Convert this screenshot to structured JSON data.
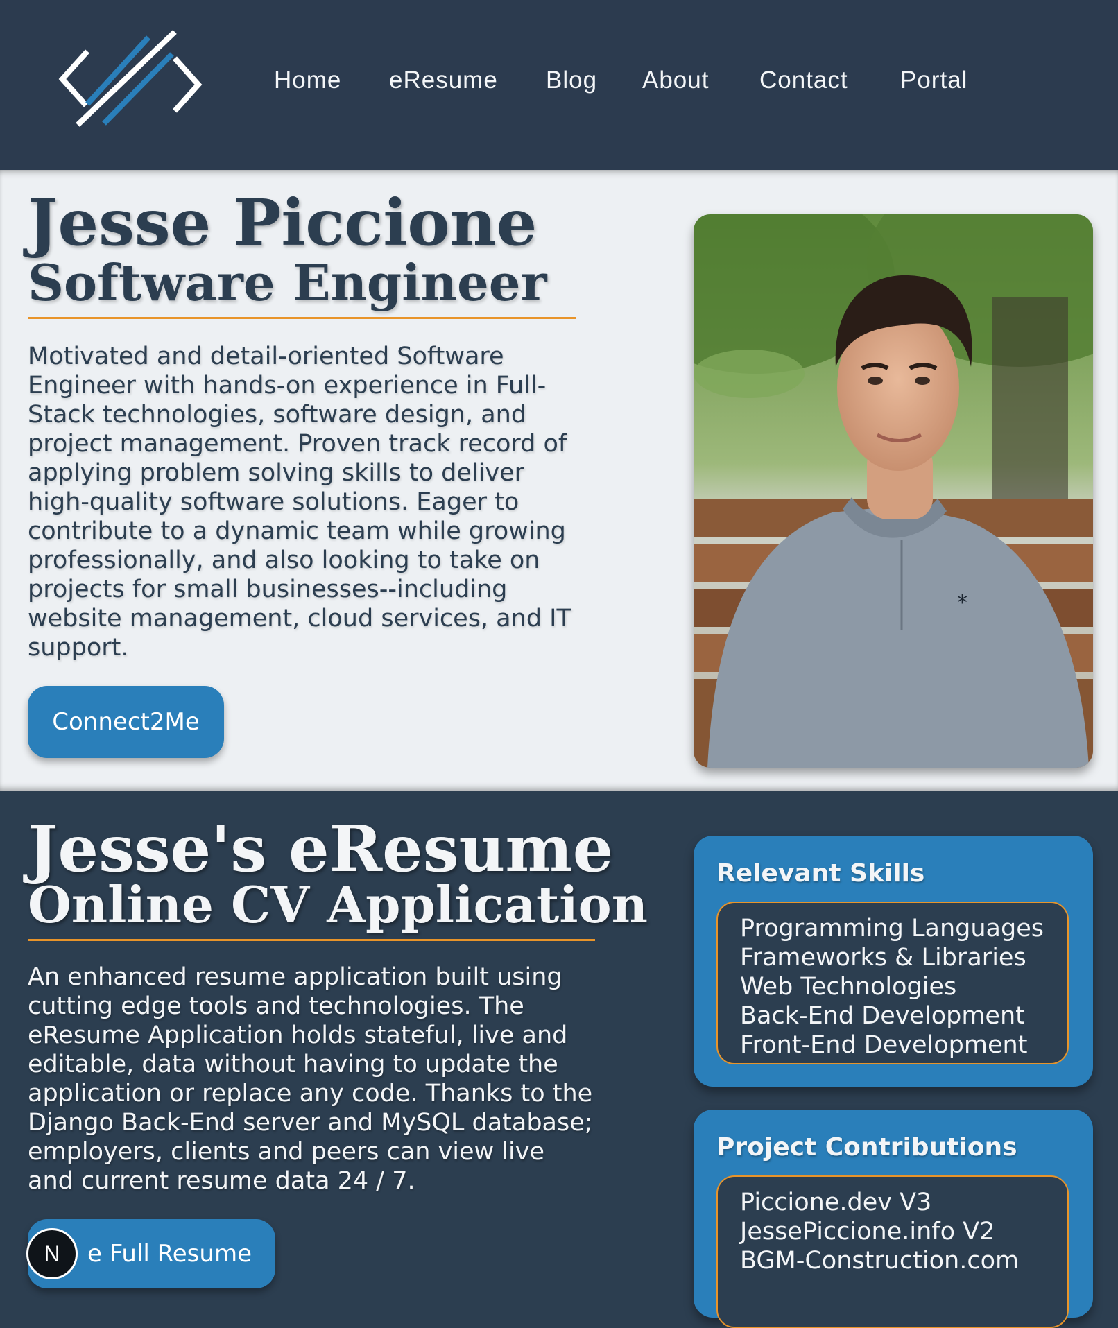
{
  "nav": {
    "items": [
      "Home",
      "eResume",
      "Blog",
      "About",
      "Contact",
      "Portal"
    ]
  },
  "hero": {
    "name": "Jesse Piccione",
    "role": "Software Engineer",
    "description": "Motivated and detail-oriented Software Engineer with hands-on experience in Full-Stack technologies, software design, and project management. Proven track record of applying problem solving skills to deliver high-quality software solutions. Eager to contribute to a dynamic team while growing professionally, and also looking to take on projects for small businesses--including website management, cloud services, and IT support.",
    "button_label": "Connect2Me"
  },
  "eresume": {
    "title": "Jesse's eResume",
    "subtitle": "Online CV Application",
    "description": "An enhanced resume application built using cutting edge tools and technologies. The eResume Application holds stateful, live and editable, data without having to update the application or replace any code. Thanks to the Django Back-End server and MySQL database; employers, clients and peers can view live and current resume data 24 / 7.",
    "button_label": "e Full Resume"
  },
  "skills_card": {
    "title": "Relevant Skills",
    "items": [
      "Programming Languages",
      "Frameworks & Libraries",
      "Web Technologies",
      "Back-End Development",
      "Front-End Development"
    ]
  },
  "projects_card": {
    "title": "Project Contributions",
    "items": [
      "Piccione.dev V3",
      "JessePiccione.info V2",
      "BGM-Construction.com"
    ]
  },
  "badge": {
    "letter": "N"
  },
  "colors": {
    "navy": "#2c3e50",
    "accent_blue": "#2a7fba",
    "accent_orange": "#e8942a",
    "light_bg": "#edf0f3"
  }
}
